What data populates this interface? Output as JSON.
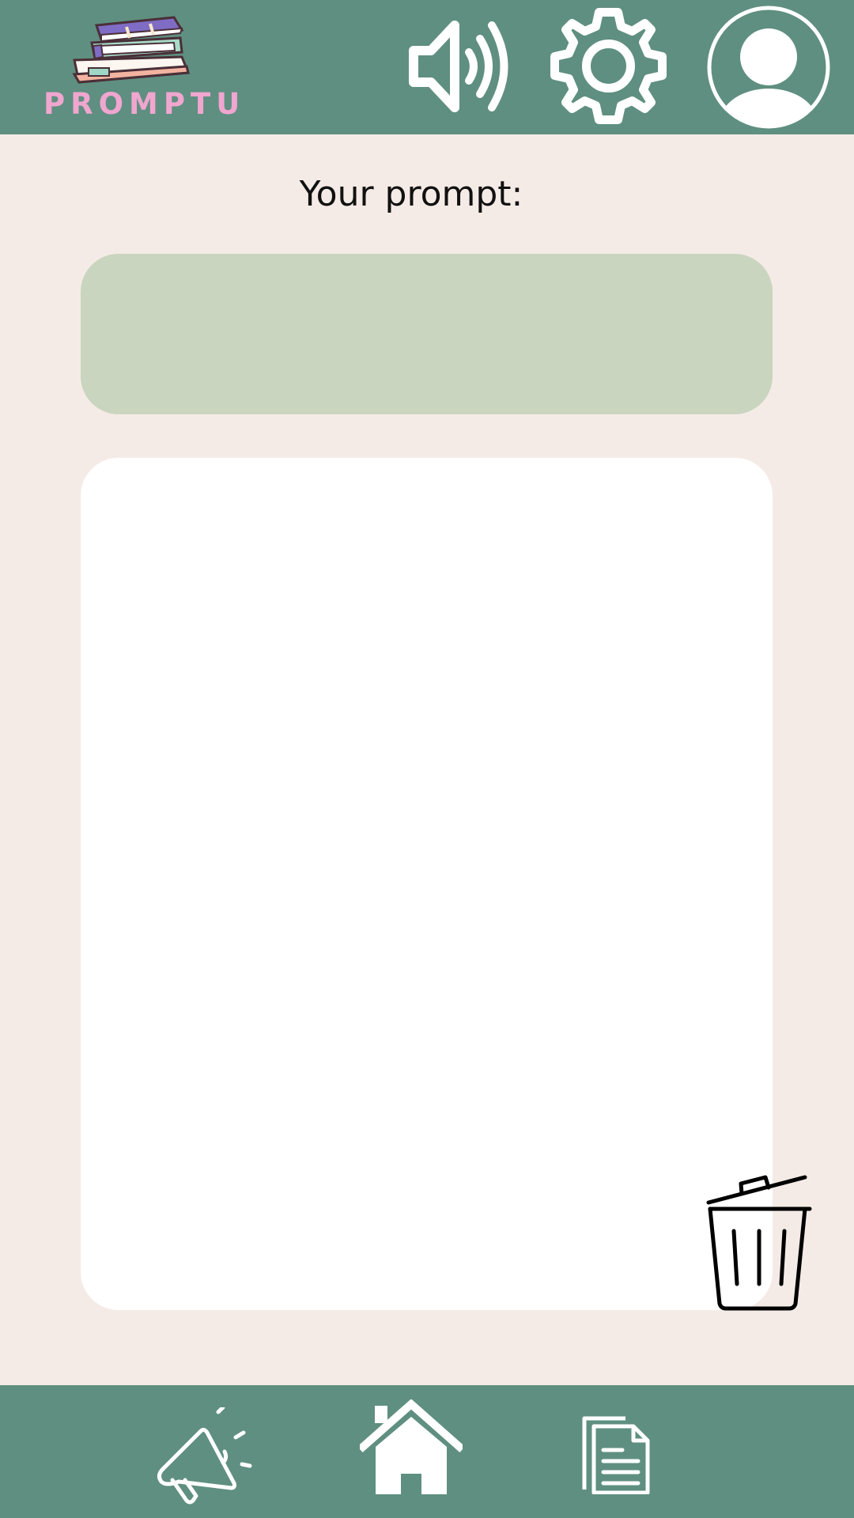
{
  "app": {
    "logo_text": "PROMPTU"
  },
  "header": {
    "icons": [
      "books-logo-icon",
      "speaker-icon",
      "settings-gear-icon",
      "user-avatar-icon"
    ]
  },
  "main": {
    "prompt_label": "Your prompt:",
    "prompt_text": "",
    "answer_text": ""
  },
  "bottom_nav": {
    "icons": [
      "megaphone-icon",
      "home-icon",
      "documents-icon"
    ]
  },
  "colors": {
    "bar": "#5f8f80",
    "background": "#f5ebe6",
    "prompt_box": "#c9d5bf",
    "answer_box": "#ffffff",
    "logo_text": "#f0a6cf"
  }
}
